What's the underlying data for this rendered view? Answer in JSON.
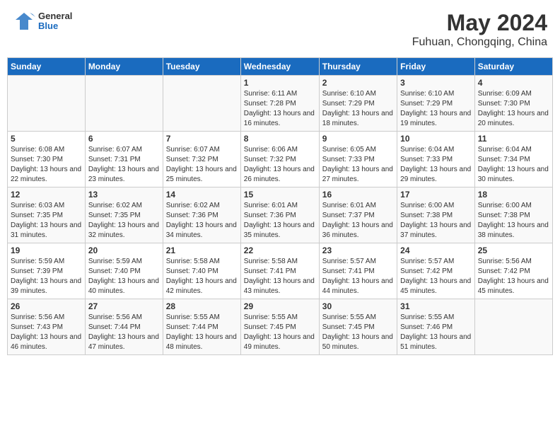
{
  "header": {
    "logo_general": "General",
    "logo_blue": "Blue",
    "main_title": "May 2024",
    "sub_title": "Fuhuan, Chongqing, China"
  },
  "weekdays": [
    "Sunday",
    "Monday",
    "Tuesday",
    "Wednesday",
    "Thursday",
    "Friday",
    "Saturday"
  ],
  "weeks": [
    [
      {
        "num": "",
        "info": ""
      },
      {
        "num": "",
        "info": ""
      },
      {
        "num": "",
        "info": ""
      },
      {
        "num": "1",
        "info": "Sunrise: 6:11 AM\nSunset: 7:28 PM\nDaylight: 13 hours\nand 16 minutes."
      },
      {
        "num": "2",
        "info": "Sunrise: 6:10 AM\nSunset: 7:29 PM\nDaylight: 13 hours\nand 18 minutes."
      },
      {
        "num": "3",
        "info": "Sunrise: 6:10 AM\nSunset: 7:29 PM\nDaylight: 13 hours\nand 19 minutes."
      },
      {
        "num": "4",
        "info": "Sunrise: 6:09 AM\nSunset: 7:30 PM\nDaylight: 13 hours\nand 20 minutes."
      }
    ],
    [
      {
        "num": "5",
        "info": "Sunrise: 6:08 AM\nSunset: 7:30 PM\nDaylight: 13 hours\nand 22 minutes."
      },
      {
        "num": "6",
        "info": "Sunrise: 6:07 AM\nSunset: 7:31 PM\nDaylight: 13 hours\nand 23 minutes."
      },
      {
        "num": "7",
        "info": "Sunrise: 6:07 AM\nSunset: 7:32 PM\nDaylight: 13 hours\nand 25 minutes."
      },
      {
        "num": "8",
        "info": "Sunrise: 6:06 AM\nSunset: 7:32 PM\nDaylight: 13 hours\nand 26 minutes."
      },
      {
        "num": "9",
        "info": "Sunrise: 6:05 AM\nSunset: 7:33 PM\nDaylight: 13 hours\nand 27 minutes."
      },
      {
        "num": "10",
        "info": "Sunrise: 6:04 AM\nSunset: 7:33 PM\nDaylight: 13 hours\nand 29 minutes."
      },
      {
        "num": "11",
        "info": "Sunrise: 6:04 AM\nSunset: 7:34 PM\nDaylight: 13 hours\nand 30 minutes."
      }
    ],
    [
      {
        "num": "12",
        "info": "Sunrise: 6:03 AM\nSunset: 7:35 PM\nDaylight: 13 hours\nand 31 minutes."
      },
      {
        "num": "13",
        "info": "Sunrise: 6:02 AM\nSunset: 7:35 PM\nDaylight: 13 hours\nand 32 minutes."
      },
      {
        "num": "14",
        "info": "Sunrise: 6:02 AM\nSunset: 7:36 PM\nDaylight: 13 hours\nand 34 minutes."
      },
      {
        "num": "15",
        "info": "Sunrise: 6:01 AM\nSunset: 7:36 PM\nDaylight: 13 hours\nand 35 minutes."
      },
      {
        "num": "16",
        "info": "Sunrise: 6:01 AM\nSunset: 7:37 PM\nDaylight: 13 hours\nand 36 minutes."
      },
      {
        "num": "17",
        "info": "Sunrise: 6:00 AM\nSunset: 7:38 PM\nDaylight: 13 hours\nand 37 minutes."
      },
      {
        "num": "18",
        "info": "Sunrise: 6:00 AM\nSunset: 7:38 PM\nDaylight: 13 hours\nand 38 minutes."
      }
    ],
    [
      {
        "num": "19",
        "info": "Sunrise: 5:59 AM\nSunset: 7:39 PM\nDaylight: 13 hours\nand 39 minutes."
      },
      {
        "num": "20",
        "info": "Sunrise: 5:59 AM\nSunset: 7:40 PM\nDaylight: 13 hours\nand 40 minutes."
      },
      {
        "num": "21",
        "info": "Sunrise: 5:58 AM\nSunset: 7:40 PM\nDaylight: 13 hours\nand 42 minutes."
      },
      {
        "num": "22",
        "info": "Sunrise: 5:58 AM\nSunset: 7:41 PM\nDaylight: 13 hours\nand 43 minutes."
      },
      {
        "num": "23",
        "info": "Sunrise: 5:57 AM\nSunset: 7:41 PM\nDaylight: 13 hours\nand 44 minutes."
      },
      {
        "num": "24",
        "info": "Sunrise: 5:57 AM\nSunset: 7:42 PM\nDaylight: 13 hours\nand 45 minutes."
      },
      {
        "num": "25",
        "info": "Sunrise: 5:56 AM\nSunset: 7:42 PM\nDaylight: 13 hours\nand 45 minutes."
      }
    ],
    [
      {
        "num": "26",
        "info": "Sunrise: 5:56 AM\nSunset: 7:43 PM\nDaylight: 13 hours\nand 46 minutes."
      },
      {
        "num": "27",
        "info": "Sunrise: 5:56 AM\nSunset: 7:44 PM\nDaylight: 13 hours\nand 47 minutes."
      },
      {
        "num": "28",
        "info": "Sunrise: 5:55 AM\nSunset: 7:44 PM\nDaylight: 13 hours\nand 48 minutes."
      },
      {
        "num": "29",
        "info": "Sunrise: 5:55 AM\nSunset: 7:45 PM\nDaylight: 13 hours\nand 49 minutes."
      },
      {
        "num": "30",
        "info": "Sunrise: 5:55 AM\nSunset: 7:45 PM\nDaylight: 13 hours\nand 50 minutes."
      },
      {
        "num": "31",
        "info": "Sunrise: 5:55 AM\nSunset: 7:46 PM\nDaylight: 13 hours\nand 51 minutes."
      },
      {
        "num": "",
        "info": ""
      }
    ]
  ]
}
